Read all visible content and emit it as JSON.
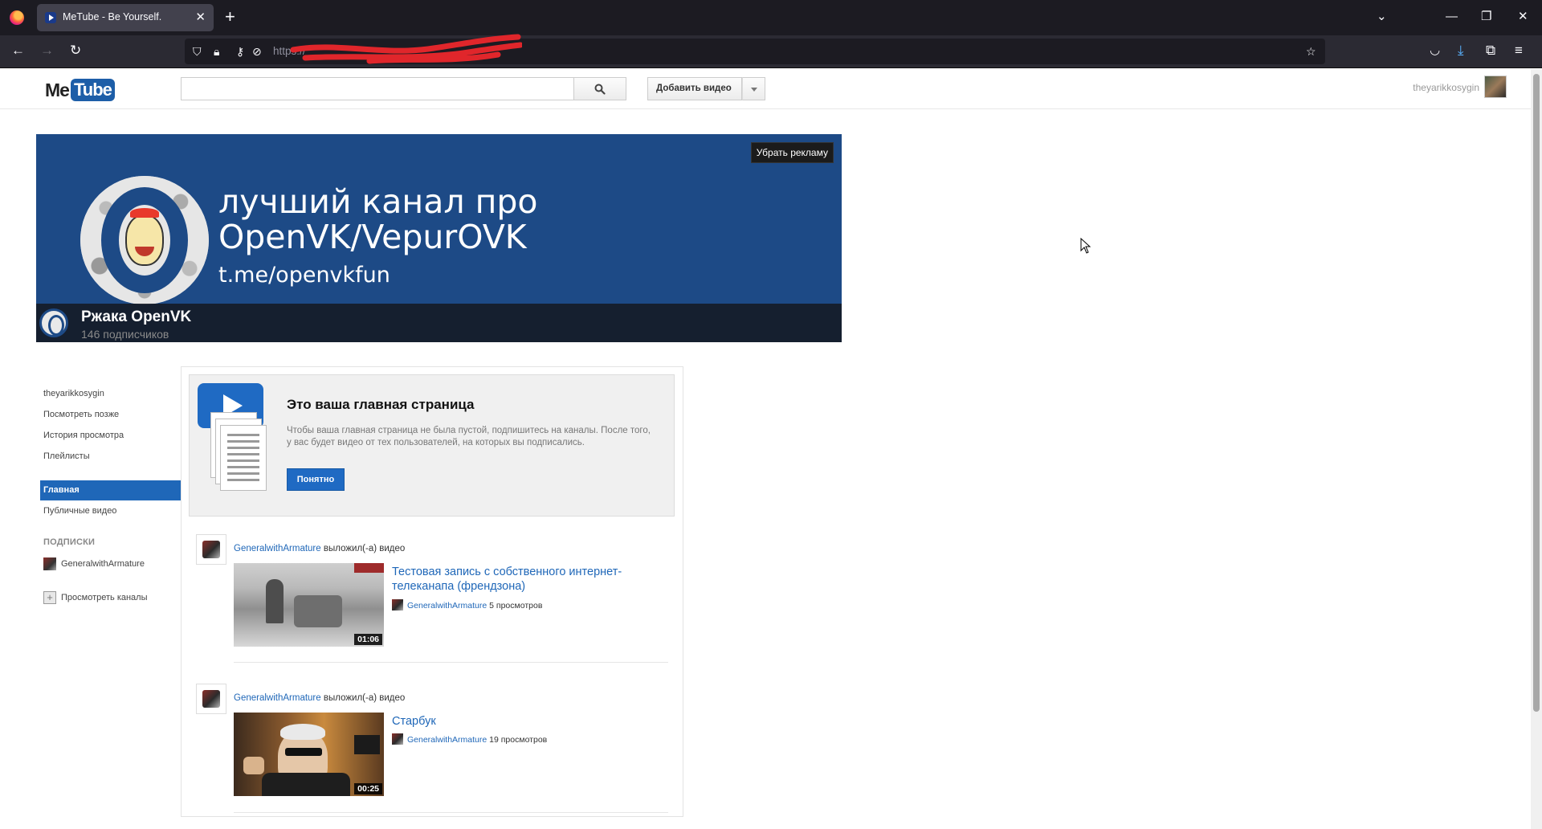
{
  "browser": {
    "tab_title": "MeTube - Be Yourself.",
    "url": "https://"
  },
  "header": {
    "logo_me": "Me",
    "logo_tube": "Tube",
    "search_placeholder": "",
    "upload_label": "Добавить видео",
    "username": "theyarikkosygin"
  },
  "banner": {
    "ad_remove": "Убрать рекламу",
    "line1": "лучший канал про",
    "line2": "OpenVK/VepurOVK",
    "line3": "t.me/openvkfun",
    "channel_name": "Ржака OpenVK",
    "subscribers": "146 подписчиков"
  },
  "sidebar": {
    "items": [
      {
        "label": "theyarikkosygin"
      },
      {
        "label": "Посмотреть позже"
      },
      {
        "label": "История просмотра"
      },
      {
        "label": "Плейлисты"
      }
    ],
    "active": "Главная",
    "public": "Публичные видео",
    "subs_header": "ПОДПИСКИ",
    "subscription": "GeneralwithArmature",
    "browse_channels": "Просмотреть каналы"
  },
  "promo": {
    "title": "Это ваша главная страница",
    "description": "Чтобы ваша главная страница не была пустой, подпишитесь на каналы. После того, у вас будет видео от тех пользователей, на которых вы подписались.",
    "button": "Понятно"
  },
  "posts": [
    {
      "author": "GeneralwithArmature",
      "action": "выложил(-а) видео",
      "title": "Тестовая запись с собственного интернет-телеканапа (френдзона)",
      "channel": "GeneralwithArmature",
      "views": "5 просмотров",
      "duration": "01:06"
    },
    {
      "author": "GeneralwithArmature",
      "action": "выложил(-а) видео",
      "title": "Старбук",
      "channel": "GeneralwithArmature",
      "views": "19 просмотров",
      "duration": "00:25"
    }
  ],
  "colors": {
    "accent": "#1f67b8",
    "banner_bg": "#1d4a86"
  }
}
